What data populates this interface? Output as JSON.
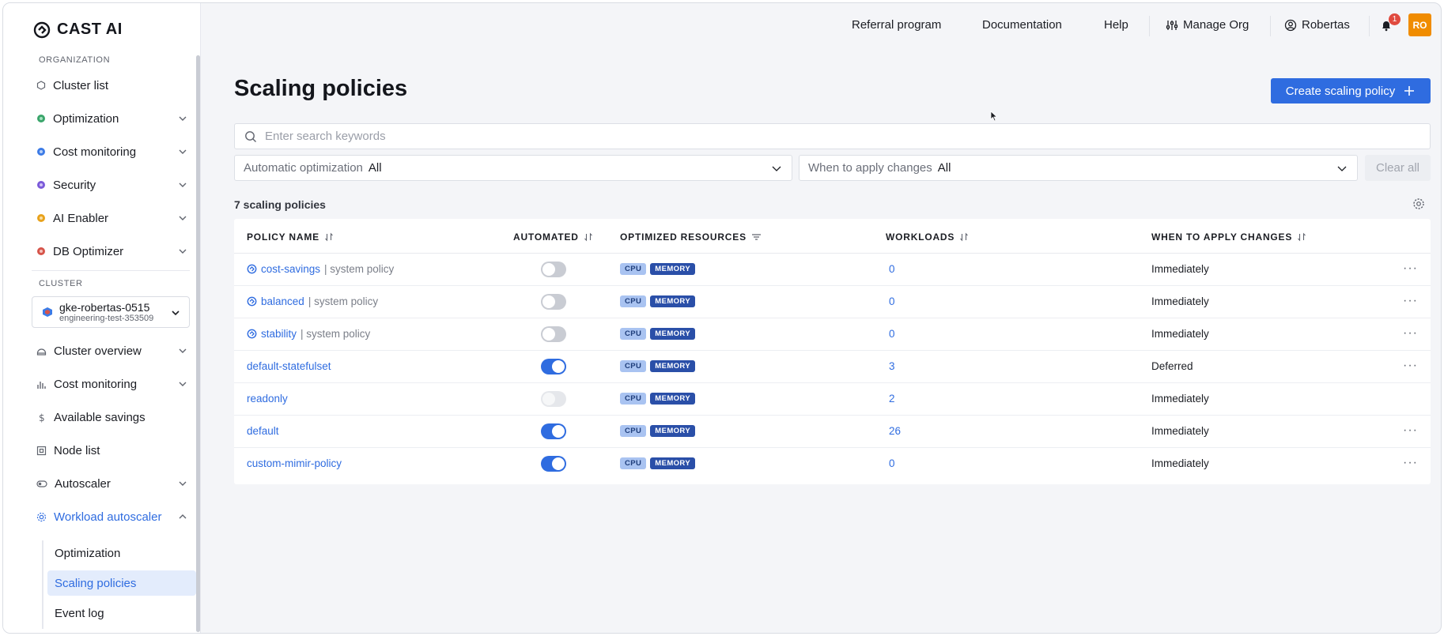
{
  "brand": {
    "name": "CAST AI"
  },
  "sidebar": {
    "organization_label": "ORGANIZATION",
    "org_items": [
      {
        "label": "Cluster list",
        "icon": "hexagon-icon"
      },
      {
        "label": "Optimization",
        "icon": "optimization-icon"
      },
      {
        "label": "Cost monitoring",
        "icon": "cost-monitoring-icon"
      },
      {
        "label": "Security",
        "icon": "security-icon"
      },
      {
        "label": "AI Enabler",
        "icon": "ai-enabler-icon"
      },
      {
        "label": "DB Optimizer",
        "icon": "db-optimizer-icon"
      }
    ],
    "cluster_label": "CLUSTER",
    "cluster": {
      "name": "gke-robertas-0515",
      "project": "engineering-test-353509"
    },
    "cluster_items": [
      {
        "label": "Cluster overview",
        "icon": "dashboard-icon"
      },
      {
        "label": "Cost monitoring",
        "icon": "bar-chart-icon"
      },
      {
        "label": "Available savings",
        "icon": "dollar-icon"
      },
      {
        "label": "Node list",
        "icon": "node-icon"
      },
      {
        "label": "Autoscaler",
        "icon": "toggle-icon"
      },
      {
        "label": "Workload autoscaler",
        "icon": "gear-icon"
      }
    ],
    "sub_items": [
      {
        "label": "Optimization"
      },
      {
        "label": "Scaling policies"
      },
      {
        "label": "Event log"
      }
    ]
  },
  "topbar": {
    "referral": "Referral program",
    "documentation": "Documentation",
    "help": "Help",
    "manage_org": "Manage Org",
    "user": "Robertas",
    "notifications_count": "1",
    "avatar_initials": "RO"
  },
  "page": {
    "title": "Scaling policies",
    "create_button": "Create scaling policy",
    "search_placeholder": "Enter search keywords",
    "filters": {
      "auto_label": "Automatic optimization",
      "auto_value": "All",
      "when_label": "When to apply changes",
      "when_value": "All",
      "clear": "Clear all"
    },
    "count_text": "7 scaling policies"
  },
  "table": {
    "columns": {
      "name": "POLICY NAME",
      "automated": "AUTOMATED",
      "resources": "OPTIMIZED RESOURCES",
      "workloads": "WORKLOADS",
      "when": "WHEN TO APPLY CHANGES"
    },
    "rows": [
      {
        "name": "cost-savings",
        "system": "| system policy",
        "automated": "off",
        "cpu": "CPU",
        "memory": "MEMORY",
        "workloads": "0",
        "when": "Immediately"
      },
      {
        "name": "balanced",
        "system": "| system policy",
        "automated": "off",
        "cpu": "CPU",
        "memory": "MEMORY",
        "workloads": "0",
        "when": "Immediately"
      },
      {
        "name": "stability",
        "system": "| system policy",
        "automated": "off",
        "cpu": "CPU",
        "memory": "MEMORY",
        "workloads": "0",
        "when": "Immediately"
      },
      {
        "name": "default-statefulset",
        "system": "",
        "automated": "on",
        "cpu": "CPU",
        "memory": "MEMORY",
        "workloads": "3",
        "when": "Deferred"
      },
      {
        "name": "readonly",
        "system": "",
        "automated": "disabled",
        "cpu": "CPU",
        "memory": "MEMORY",
        "workloads": "2",
        "when": "Immediately"
      },
      {
        "name": "default",
        "system": "",
        "automated": "on",
        "cpu": "CPU",
        "memory": "MEMORY",
        "workloads": "26",
        "when": "Immediately"
      },
      {
        "name": "custom-mimir-policy",
        "system": "",
        "automated": "on",
        "cpu": "CPU",
        "memory": "MEMORY",
        "workloads": "0",
        "when": "Immediately"
      }
    ],
    "more_symbol": "···"
  },
  "colors": {
    "accent": "#2f6ce0",
    "avatar": "#f08c00",
    "badge": "#e04a3f"
  }
}
